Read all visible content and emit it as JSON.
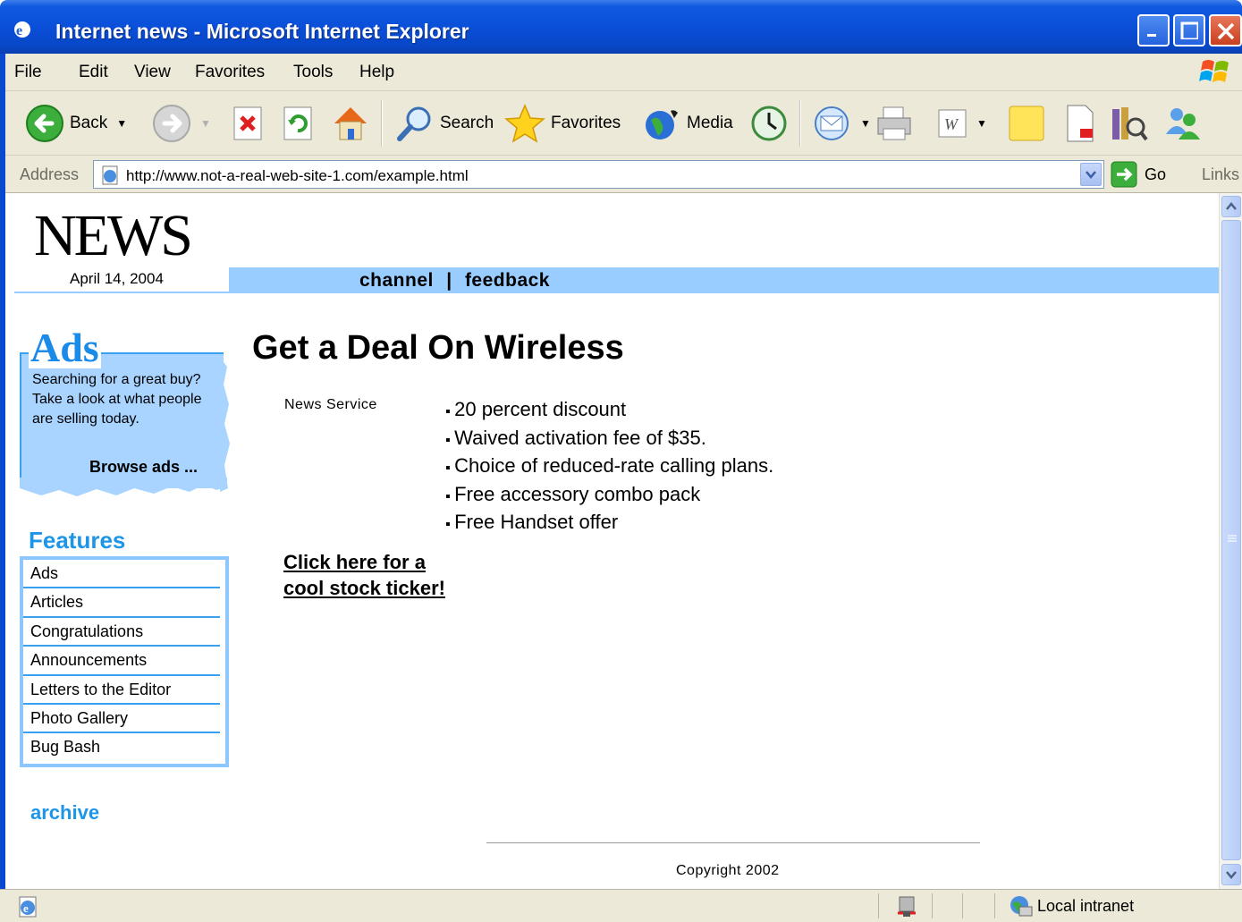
{
  "window": {
    "title": "Internet news - Microsoft Internet Explorer"
  },
  "menubar": {
    "items": [
      "File",
      "Edit",
      "View",
      "Favorites",
      "Tools",
      "Help"
    ]
  },
  "toolbar": {
    "back_label": "Back",
    "search_label": "Search",
    "favorites_label": "Favorites",
    "media_label": "Media"
  },
  "addressbar": {
    "label": "Address",
    "url": "http://www.not-a-real-web-site-1.com/example.html",
    "go_label": "Go",
    "links_label": "Links"
  },
  "page": {
    "logo": "NEWS",
    "date": "April 14, 2004",
    "nav_channel": "channel",
    "nav_separator": "|",
    "nav_feedback": "feedback",
    "ads": {
      "title": "Ads",
      "text": "Searching for a great buy? Take a look at what people are selling today.",
      "link": "Browse ads ..."
    },
    "features": {
      "title": "Features",
      "items": [
        "Ads",
        "Articles",
        "Congratulations",
        "Announcements",
        "Letters to the Editor",
        "Photo Gallery",
        "Bug Bash"
      ]
    },
    "archive": "archive",
    "article": {
      "headline": "Get a Deal On Wireless",
      "source": "News Service",
      "bullets": [
        "20 percent discount",
        "Waived activation fee of $35.",
        "Choice of reduced-rate calling plans.",
        "Free accessory combo pack",
        "Free Handset offer"
      ],
      "ticker_link": "Click here for a cool stock ticker!"
    },
    "copyright": "Copyright 2002"
  },
  "statusbar": {
    "zone": "Local intranet"
  },
  "colors": {
    "nav_bar": "#99ccff",
    "accent_blue": "#1e96e8",
    "title_bar": "#0a4fd8",
    "chrome": "#ece9d8"
  }
}
